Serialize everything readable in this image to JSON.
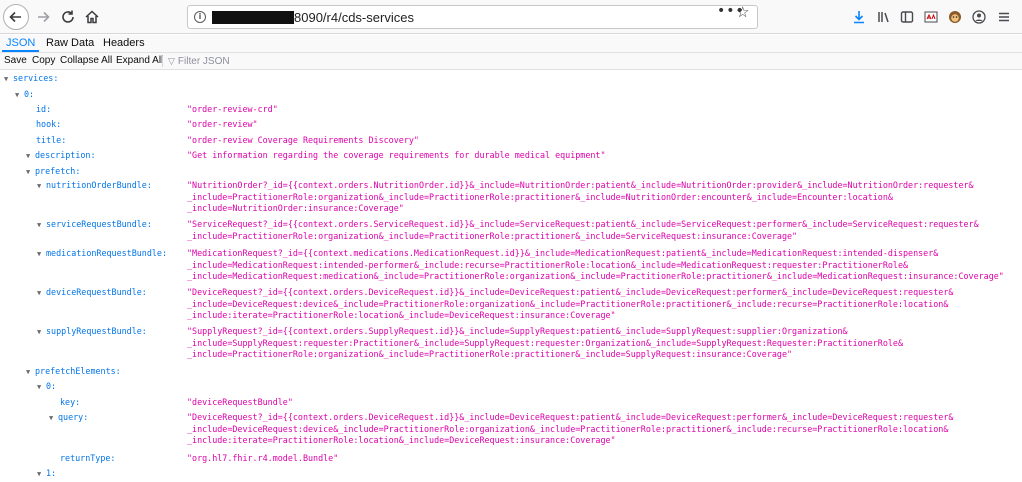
{
  "browser": {
    "url_suffix": "8090/r4/cds-services",
    "page_actions": "•••",
    "bookmark_star": "☆"
  },
  "viewer_tabs": [
    {
      "label": "JSON",
      "active": true
    },
    {
      "label": "Raw Data",
      "active": false
    },
    {
      "label": "Headers",
      "active": false
    }
  ],
  "viewer_actions": {
    "save": "Save",
    "copy": "Copy",
    "collapse_all": "Collapse All",
    "expand_all": "Expand All",
    "filter_placeholder": "Filter JSON"
  },
  "tree": [
    {
      "key": "services:",
      "expandable": true
    },
    {
      "key": "0:",
      "expandable": true
    },
    {
      "key": "id:",
      "value": "\"order-review-crd\""
    },
    {
      "key": "hook:",
      "value": "\"order-review\""
    },
    {
      "key": "title:",
      "value": "\"order-review Coverage Requirements Discovery\""
    },
    {
      "key": "description:",
      "expandable": true,
      "value": "\"Get information regarding the coverage requirements for durable medical equipment\""
    },
    {
      "key": "prefetch:",
      "expandable": true
    },
    {
      "key": "nutritionOrderBundle:",
      "expandable": true,
      "value": "\"NutritionOrder?_id={{context.orders.NutritionOrder.id}}&_include=NutritionOrder:patient&_include=NutritionOrder:provider&_include=NutritionOrder:requester&\n_include=PractitionerRole:organization&_include=PractitionerRole:practitioner&_include=NutritionOrder:encounter&_include=Encounter:location&\n_include=NutritionOrder:insurance:Coverage\""
    },
    {
      "key": "serviceRequestBundle:",
      "expandable": true,
      "value": "\"ServiceRequest?_id={{context.orders.ServiceRequest.id}}&_include=ServiceRequest:patient&_include=ServiceRequest:performer&_include=ServiceRequest:requester&\n_include=PractitionerRole:organization&_include=PractitionerRole:practitioner&_include=ServiceRequest:insurance:Coverage\""
    },
    {
      "key": "medicationRequestBundle:",
      "expandable": true,
      "value": "\"MedicationRequest?_id={{context.medications.MedicationRequest.id}}&_include=MedicationRequest:patient&_include=MedicationRequest:intended-dispenser&\n_include=MedicationRequest:intended-performer&_include:recurse=PractitionerRole:location&_include=MedicationRequest:requester:PractitionerRole&\n_include=MedicationRequest:medication&_include=PractitionerRole:organization&_include=PractitionerRole:practitioner&_include=MedicationRequest:insurance:Coverage\""
    },
    {
      "key": "deviceRequestBundle:",
      "expandable": true,
      "value": "\"DeviceRequest?_id={{context.orders.DeviceRequest.id}}&_include=DeviceRequest:patient&_include=DeviceRequest:performer&_include=DeviceRequest:requester&\n_include=DeviceRequest:device&_include=PractitionerRole:organization&_include=PractitionerRole:practitioner&_include:recurse=PractitionerRole:location&\n_include:iterate=PractitionerRole:location&_include=DeviceRequest:insurance:Coverage\""
    },
    {
      "key": "supplyRequestBundle:",
      "expandable": true,
      "value": "\"SupplyRequest?_id={{context.orders.SupplyRequest.id}}&_include=SupplyRequest:patient&_include=SupplyRequest:supplier:Organization&\n_include=SupplyRequest:requester:Practitioner&_include=SupplyRequest:requester:Organization&_include=SupplyRequest:Requester:PractitionerRole&\n_include=PractitionerRole:organization&_include=PractitionerRole:practitioner&_include=SupplyRequest:insurance:Coverage\""
    },
    {
      "key": "prefetchElements:",
      "expandable": true
    },
    {
      "key": "0:",
      "expandable": true
    },
    {
      "key": "key:",
      "value": "\"deviceRequestBundle\""
    },
    {
      "key": "query:",
      "expandable": true,
      "value": "\"DeviceRequest?_id={{context.orders.DeviceRequest.id}}&_include=DeviceRequest:patient&_include=DeviceRequest:performer&_include=DeviceRequest:requester&\n_include=DeviceRequest:device&_include=PractitionerRole:organization&_include=PractitionerRole:practitioner&_include:recurse=PractitionerRole:location&\n_include:iterate=PractitionerRole:location&_include=DeviceRequest:insurance:Coverage\""
    },
    {
      "key": "returnType:",
      "value": "\"org.hl7.fhir.r4.model.Bundle\""
    },
    {
      "key": "1:",
      "expandable": true
    }
  ]
}
